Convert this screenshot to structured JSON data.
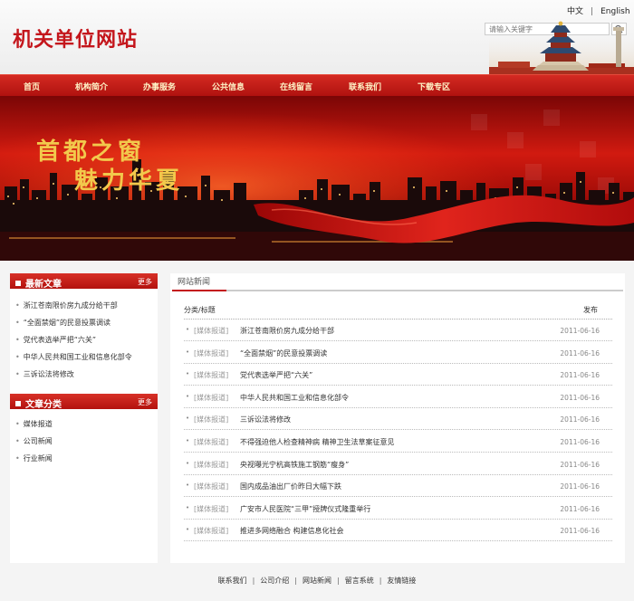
{
  "header": {
    "site_title": "机关单位网站",
    "lang_cn": "中文",
    "lang_sep": "|",
    "lang_en": "English",
    "search_placeholder": "请输入关键字",
    "search_icon": "magnifier-icon"
  },
  "nav": [
    "首页",
    "机构简介",
    "办事服务",
    "公共信息",
    "在线留言",
    "联系我们",
    "下载专区"
  ],
  "banner": {
    "line1": "首都之窗",
    "line2": "魅力华夏"
  },
  "sidebar": {
    "latest": {
      "title": "最新文章",
      "more": "更多",
      "items": [
        "浙江苍南限价房九成分给干部",
        "“全面禁烟”的民意投票调读",
        "党代表选举严把“六关”",
        "中华人民共和国工业和信息化部令",
        "三诉讼法将修改"
      ]
    },
    "categories": {
      "title": "文章分类",
      "more": "更多",
      "items": [
        "媒体报道",
        "公司新闻",
        "行业新闻"
      ]
    }
  },
  "main": {
    "tab": "网站新闻",
    "col_title": "分类/标题",
    "col_date": "发布",
    "rows": [
      {
        "cat": "[媒体报道]",
        "title": "浙江苍南限价房九成分给干部",
        "date": "2011-06-16"
      },
      {
        "cat": "[媒体报道]",
        "title": "“全面禁烟”的民意投票调读",
        "date": "2011-06-16"
      },
      {
        "cat": "[媒体报道]",
        "title": "党代表选举严把“六关”",
        "date": "2011-06-16"
      },
      {
        "cat": "[媒体报道]",
        "title": "中华人民共和国工业和信息化部令",
        "date": "2011-06-16"
      },
      {
        "cat": "[媒体报道]",
        "title": "三诉讼法将修改",
        "date": "2011-06-16"
      },
      {
        "cat": "[媒体报道]",
        "title": "不得强迫他人检查精神病 精神卫生法草案征意见",
        "date": "2011-06-16"
      },
      {
        "cat": "[媒体报道]",
        "title": "央视曝光宁杭高铁施工钢筋“瘦身”",
        "date": "2011-06-16"
      },
      {
        "cat": "[媒体报道]",
        "title": "国内成品油出厂价昨日大幅下跌",
        "date": "2011-06-16"
      },
      {
        "cat": "[媒体报道]",
        "title": "广安市人民医院“三甲”授牌仪式隆重举行",
        "date": "2011-06-16"
      },
      {
        "cat": "[媒体报道]",
        "title": "推进多网络融合 构建信息化社会",
        "date": "2011-06-16"
      }
    ]
  },
  "footer": {
    "links": [
      "联系我们",
      "公司介绍",
      "网站新闻",
      "留言系统",
      "友情链接"
    ],
    "sep": "|"
  },
  "colors": {
    "brand_red": "#c4161c",
    "nav_text": "#fff5c8",
    "banner_text": "#f2c94c"
  }
}
